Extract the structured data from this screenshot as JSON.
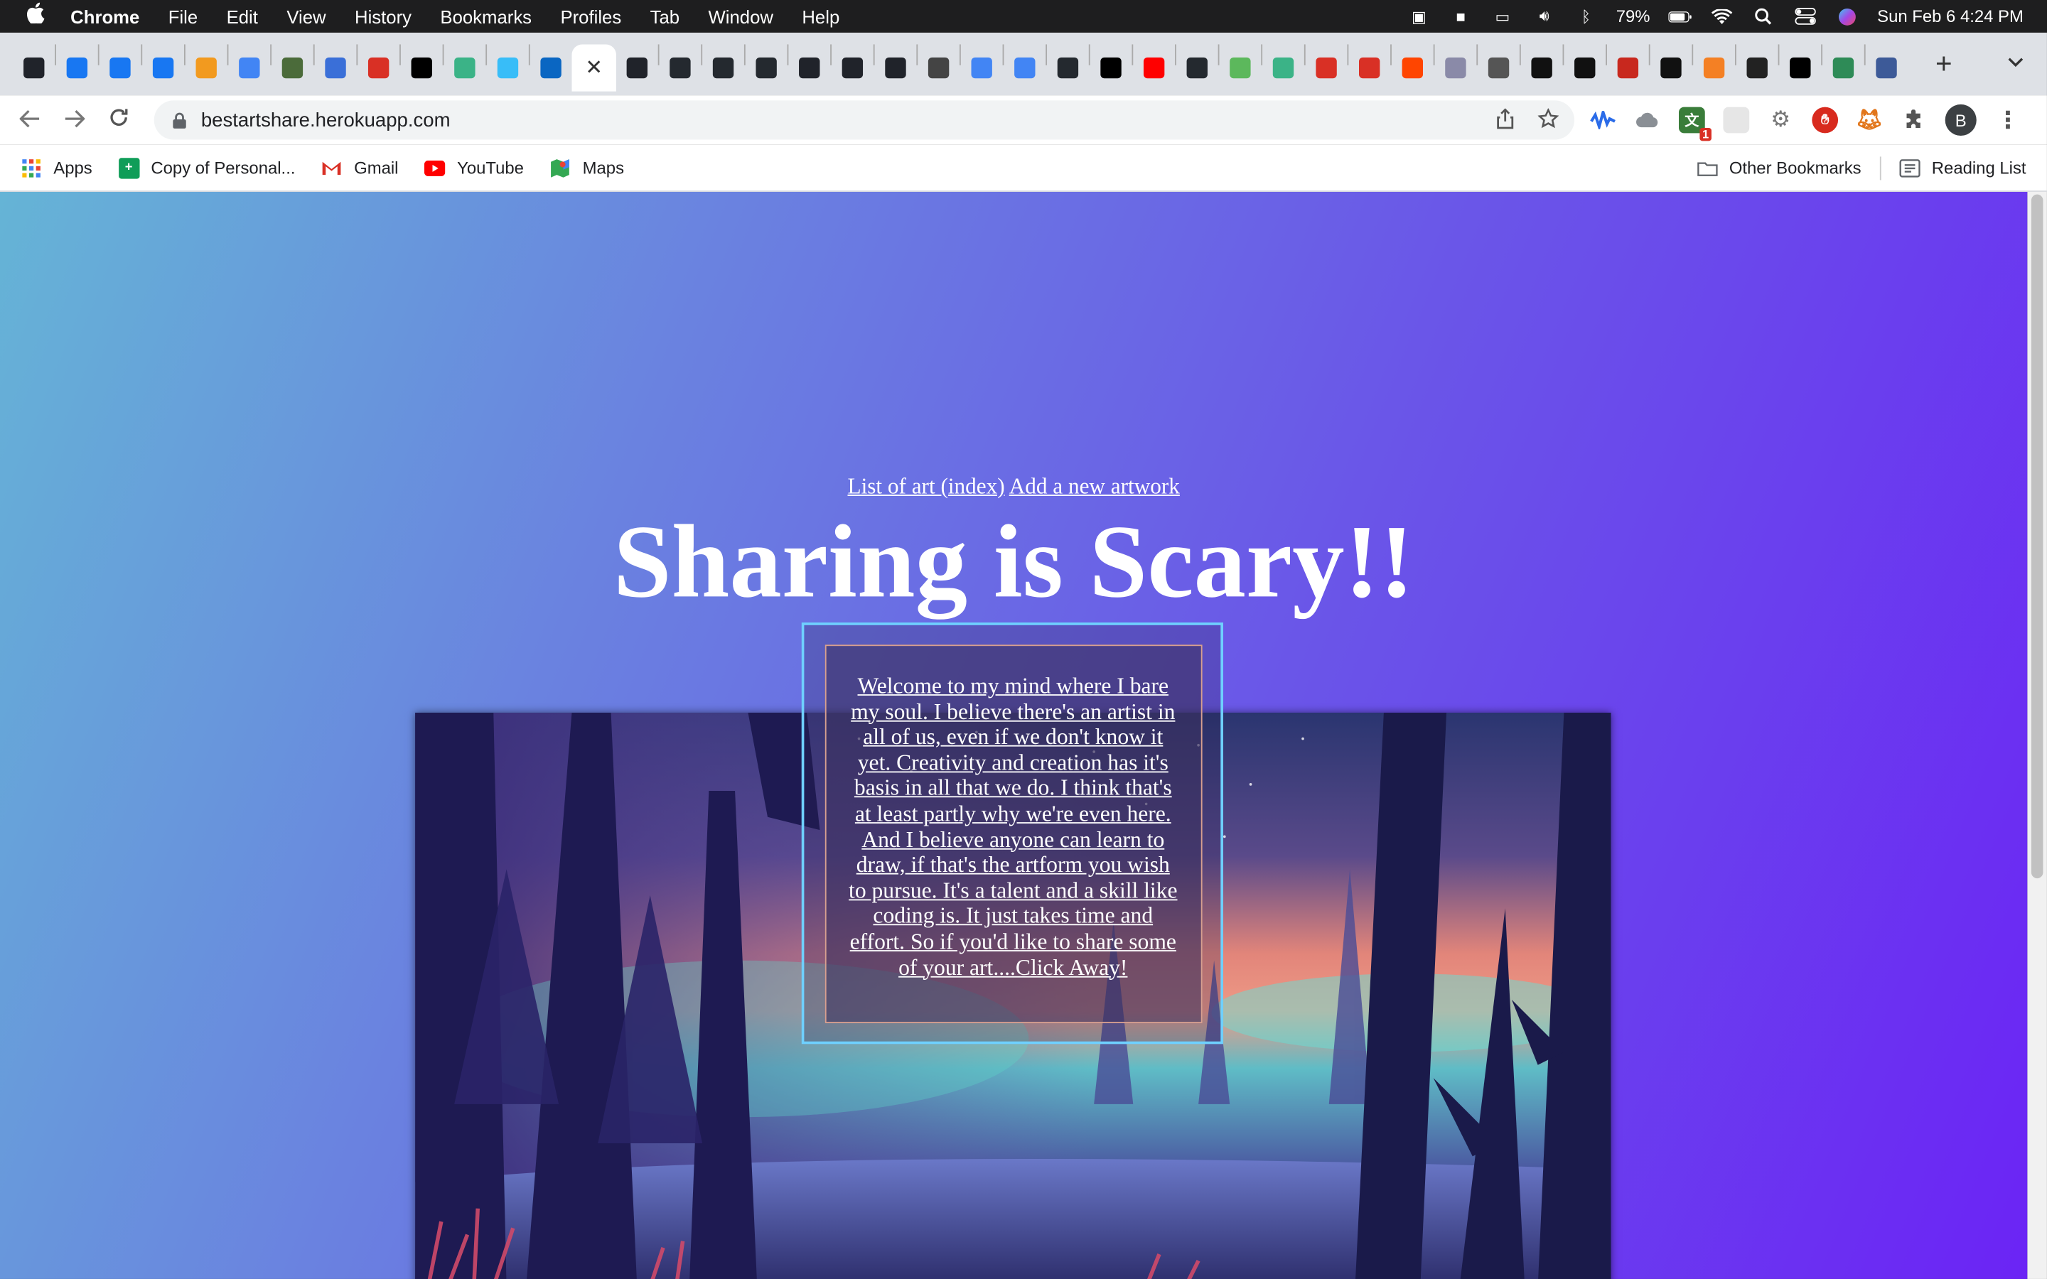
{
  "menubar": {
    "app": "Chrome",
    "items": [
      "File",
      "Edit",
      "View",
      "History",
      "Bookmarks",
      "Profiles",
      "Tab",
      "Window",
      "Help"
    ],
    "battery": "79%",
    "datetime": "Sun Feb 6  4:24 PM"
  },
  "tabs": {
    "favicons": [
      {
        "icon": "react-icon",
        "color": "#20232a"
      },
      {
        "icon": "facebook-icon",
        "color": "#1877f2"
      },
      {
        "icon": "facebook-icon",
        "color": "#1877f2"
      },
      {
        "icon": "facebook-icon",
        "color": "#1877f2"
      },
      {
        "icon": "rainbow-icon",
        "color": "#f29a1f"
      },
      {
        "icon": "google-icon",
        "color": "#4285f4"
      },
      {
        "icon": "vec-icon",
        "color": "#4b6b3a"
      },
      {
        "icon": "c-icon",
        "color": "#3a6fd8"
      },
      {
        "icon": "gmail-icon",
        "color": "#d93025"
      },
      {
        "icon": "vercel-icon",
        "color": "#000000"
      },
      {
        "icon": "diamond-icon",
        "color": "#3bb387"
      },
      {
        "icon": "tailwind-icon",
        "color": "#38bdf8"
      },
      {
        "icon": "linkedin-icon",
        "color": "#0a66c2"
      }
    ],
    "favicons_after": [
      {
        "icon": "react-icon",
        "color": "#20232a"
      },
      {
        "icon": "github-icon",
        "color": "#24292f"
      },
      {
        "icon": "github-icon",
        "color": "#24292f"
      },
      {
        "icon": "github-icon",
        "color": "#24292f"
      },
      {
        "icon": "react-icon",
        "color": "#20232a"
      },
      {
        "icon": "react-icon",
        "color": "#20232a"
      },
      {
        "icon": "react-icon",
        "color": "#20232a"
      },
      {
        "icon": "globe-icon",
        "color": "#444444"
      },
      {
        "icon": "google-icon",
        "color": "#4285f4"
      },
      {
        "icon": "google-icon",
        "color": "#4285f4"
      },
      {
        "icon": "github-icon",
        "color": "#24292f"
      },
      {
        "icon": "vercel-icon",
        "color": "#000000"
      },
      {
        "icon": "youtube-icon",
        "color": "#ff0000"
      },
      {
        "icon": "github-icon",
        "color": "#24292f"
      },
      {
        "icon": "green-icon",
        "color": "#5cb85c"
      },
      {
        "icon": "diamond-icon",
        "color": "#3bb387"
      },
      {
        "icon": "gmail-icon",
        "color": "#d93025"
      },
      {
        "icon": "gmail-icon",
        "color": "#d93025"
      },
      {
        "icon": "reddit-icon",
        "color": "#ff4500"
      },
      {
        "icon": "hex-icon",
        "color": "#8a8aa8"
      },
      {
        "icon": "chrome-icon",
        "color": "#555555"
      },
      {
        "icon": "app-icon",
        "color": "#111111"
      },
      {
        "icon": "app-icon",
        "color": "#111111"
      },
      {
        "icon": "pdf-icon",
        "color": "#c8281e"
      },
      {
        "icon": "e-icon",
        "color": "#111111"
      },
      {
        "icon": "stack-icon",
        "color": "#f48024"
      },
      {
        "icon": "arrow-icon",
        "color": "#222222"
      },
      {
        "icon": "vercel-icon",
        "color": "#000000"
      },
      {
        "icon": "edit-icon",
        "color": "#2e8b57"
      },
      {
        "icon": "infinity-icon",
        "color": "#3d5a98"
      }
    ]
  },
  "toolbar": {
    "url": "bestartshare.herokuapp.com",
    "profile_initial": "B",
    "extension_badge": "1"
  },
  "bookmarks": {
    "items": [
      {
        "label": "Apps",
        "icon": "apps-grid-icon",
        "color": "#4285f4"
      },
      {
        "label": "Copy of Personal...",
        "icon": "sheets-icon",
        "color": "#0f9d58"
      },
      {
        "label": "Gmail",
        "icon": "gmail-icon",
        "color": "#d93025"
      },
      {
        "label": "YouTube",
        "icon": "youtube-icon",
        "color": "#ff0000"
      },
      {
        "label": "Maps",
        "icon": "maps-icon",
        "color": "#34a853"
      }
    ],
    "other": "Other Bookmarks",
    "reading_list": "Reading List"
  },
  "page": {
    "nav_index": "List of art (index)",
    "nav_new": "Add a new artwork",
    "title": "Sharing is Scary!!",
    "welcome": "Welcome to my mind where I bare my soul. I believe there's an artist in all of us, even if we don't know it yet. Creativity and creation has it's basis in all that we do. I think that's at least partly why we're even here. And I believe anyone can learn to draw, if that's the artform you wish to pursue. It's a talent and a skill like coding is. It just takes time and effort. So if you'd like to share some of your art....Click Away!"
  },
  "colors": {
    "gradient_start": "#65b4d6",
    "gradient_end": "#6b24f5",
    "frame_accent": "#6fd0ff"
  }
}
